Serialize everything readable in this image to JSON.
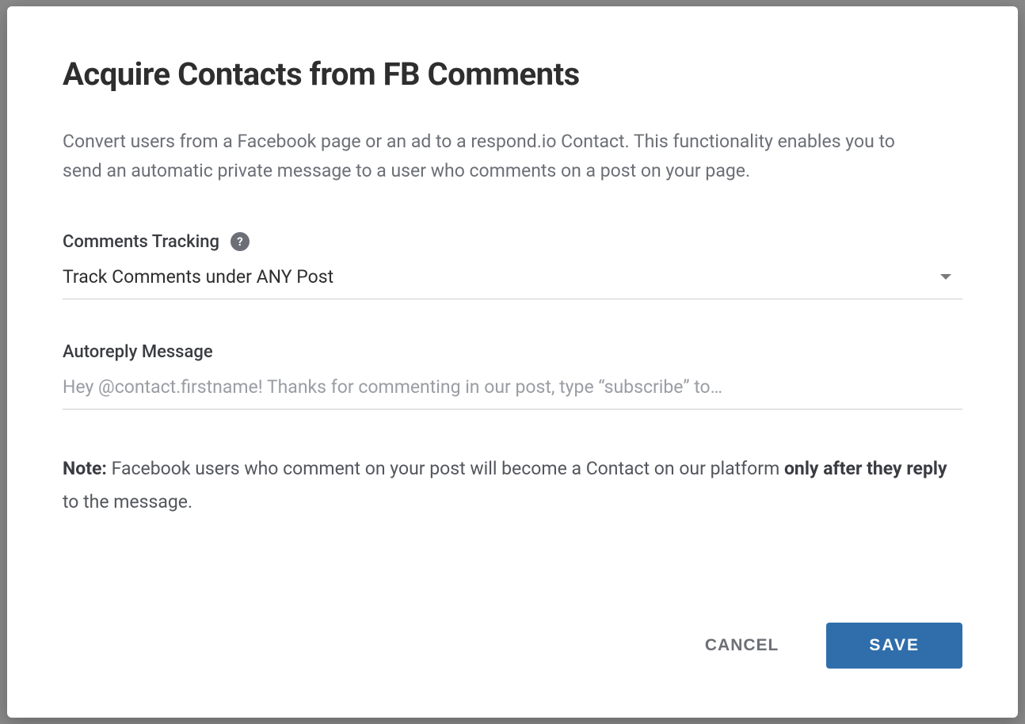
{
  "modal": {
    "title": "Acquire Contacts from FB Comments",
    "description": "Convert users from a Facebook page or an ad to a respond.io Contact. This functionality enables you to send an automatic private message to a user who comments on a post on your page.",
    "fields": {
      "tracking": {
        "label": "Comments Tracking",
        "help_symbol": "?",
        "selected": "Track Comments under ANY Post"
      },
      "autoreply": {
        "label": "Autoreply Message",
        "placeholder": "Hey @contact.firstname! Thanks for commenting in our post, type “subscribe” to…",
        "value": ""
      }
    },
    "note": {
      "prefix_bold": "Note:",
      "text_mid": " Facebook users who comment on your post will become a Contact on our platform ",
      "bold_mid": "only after they reply",
      "text_end": " to the message."
    },
    "actions": {
      "cancel": "CANCEL",
      "save": "SAVE"
    }
  }
}
